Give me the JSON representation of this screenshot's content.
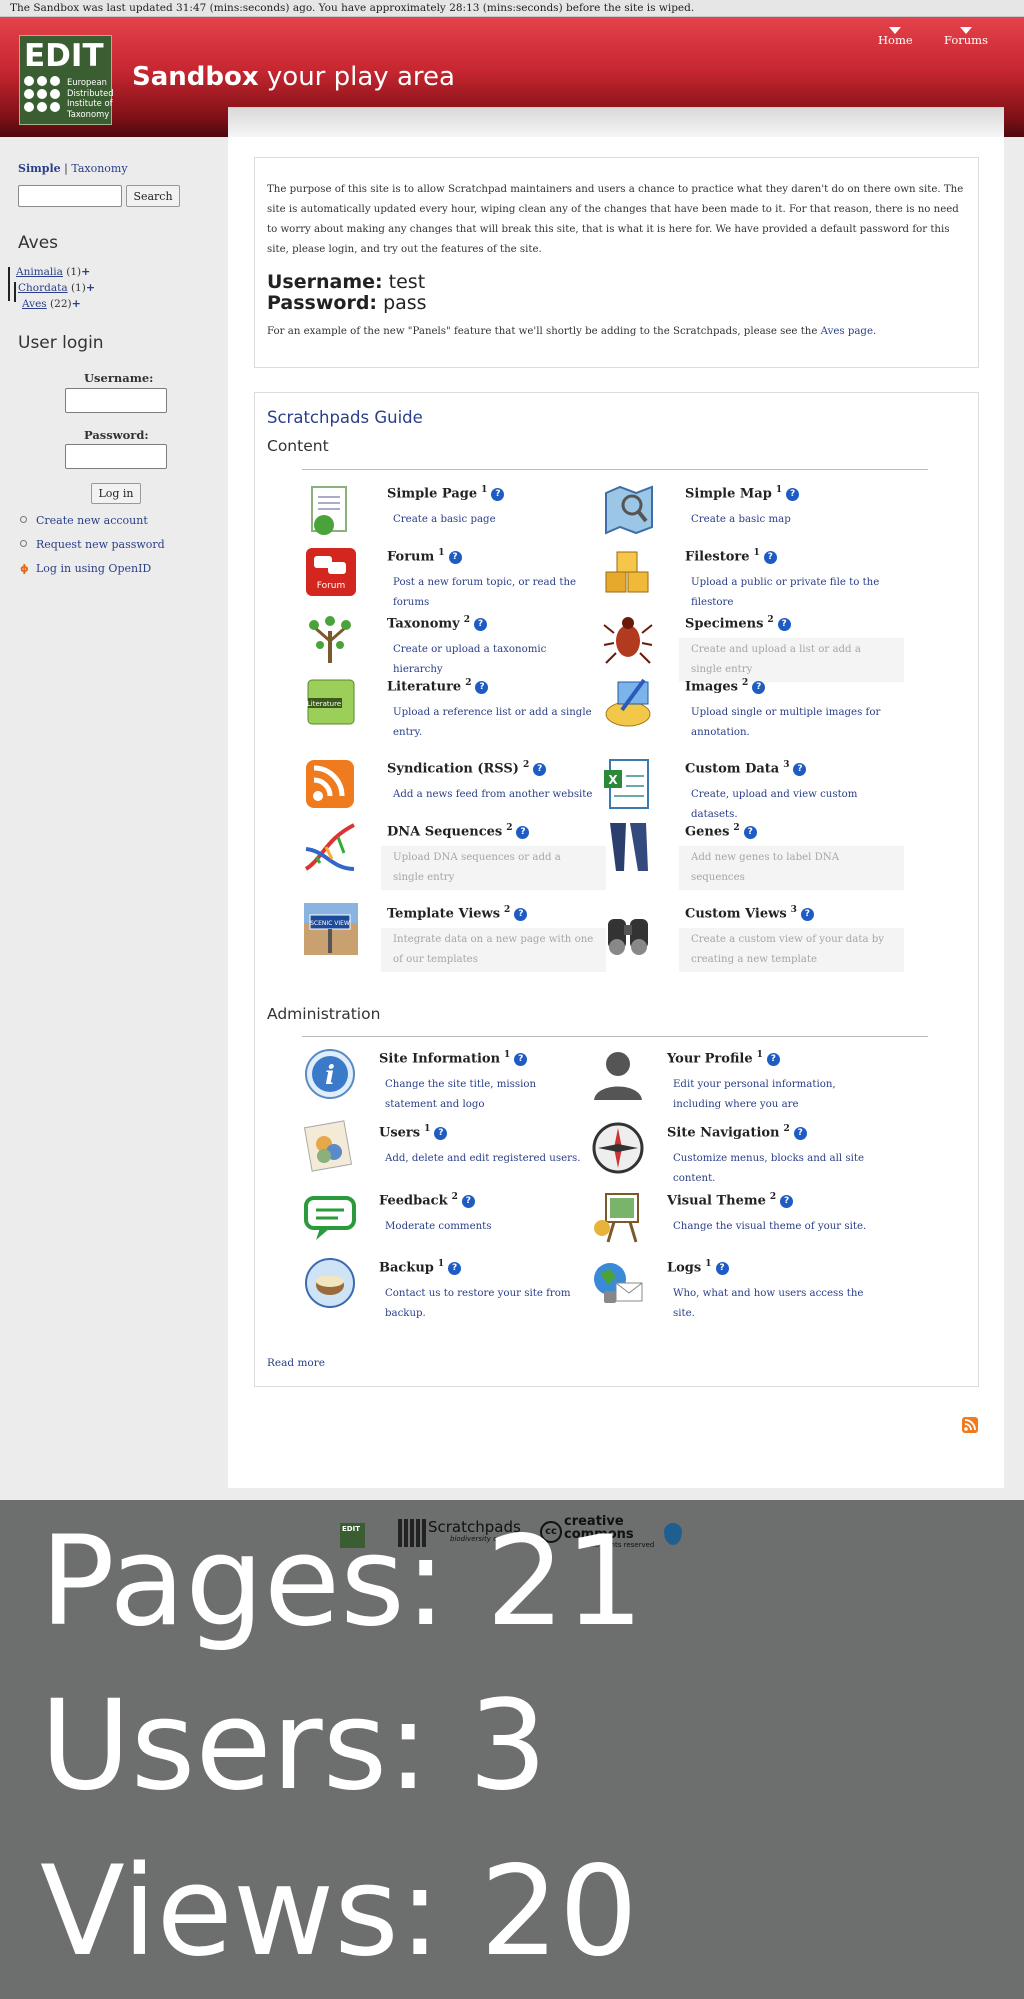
{
  "notice": "The Sandbox was last updated 31:47 (mins:seconds) ago. You have approximately 28:13 (mins:seconds) before the site is wiped.",
  "logo": {
    "main": "EDIT",
    "lines": [
      "European",
      "Distributed",
      "Institute of",
      "Taxonomy"
    ]
  },
  "site": {
    "name": "Sandbox",
    "slogan": "your play area"
  },
  "topnav": [
    "Home",
    "Forums"
  ],
  "sidebar": {
    "tabs": [
      "Simple",
      "Taxonomy"
    ],
    "tab_separator": "|",
    "search_button": "Search",
    "tree_title": "Aves",
    "tree": [
      {
        "label": "Animalia",
        "count": "(1)"
      },
      {
        "label": "Chordata",
        "count": "(1)"
      },
      {
        "label": "Aves",
        "count": "(22)"
      }
    ],
    "login_title": "User login",
    "username_label": "Username:",
    "password_label": "Password:",
    "required_mark": "*",
    "login_button": "Log in",
    "links": [
      "Create new account",
      "Request new password",
      "Log in using OpenID"
    ]
  },
  "intro": {
    "paragraph": "The purpose of this site is to allow Scratchpad maintainers and users a chance to practice what they daren't do on there own site. The site is automatically updated every hour, wiping clean any of the changes that have been made to it. For that reason, there is no need to worry about making any changes that will break this site, that is what it is here for. We have provided a default password for this site, please login, and try out the features of the site.",
    "username_label": "Username:",
    "username_value": "test",
    "password_label": "Password:",
    "password_value": "pass",
    "panels_before": "For an example of the new \"Panels\" feature that we'll shortly be adding to the Scratchpads, please see the",
    "panels_link": "Aves page",
    "panels_after": "."
  },
  "guide": {
    "title": "Scratchpads Guide",
    "content_title": "Content",
    "admin_title": "Administration",
    "help_glyph": "?",
    "read_more": "Read more",
    "content_items": [
      {
        "name": "Simple Page",
        "sup": "1",
        "desc": "Create a basic page",
        "disabled": false,
        "icon": "simple-page-icon"
      },
      {
        "name": "Simple Map",
        "sup": "1",
        "desc": "Create a basic map",
        "disabled": false,
        "icon": "simple-map-icon"
      },
      {
        "name": "Forum",
        "sup": "1",
        "desc": "Post a new forum topic, or read the forums",
        "disabled": false,
        "icon": "forum-icon"
      },
      {
        "name": "Filestore",
        "sup": "1",
        "desc": "Upload a public or private file to the filestore",
        "disabled": false,
        "icon": "filestore-icon"
      },
      {
        "name": "Taxonomy",
        "sup": "2",
        "desc": "Create or upload a taxonomic hierarchy",
        "disabled": false,
        "icon": "taxonomy-icon"
      },
      {
        "name": "Specimens",
        "sup": "2",
        "desc": "Create and upload a list or add a single entry",
        "disabled": true,
        "icon": "specimens-icon"
      },
      {
        "name": "Literature",
        "sup": "2",
        "desc": "Upload a reference list or add a single entry.",
        "disabled": false,
        "icon": "literature-icon"
      },
      {
        "name": "Images",
        "sup": "2",
        "desc": "Upload single or multiple images for annotation.",
        "disabled": false,
        "icon": "images-icon"
      },
      {
        "name": "Syndication (RSS)",
        "sup": "2",
        "desc": "Add a news feed from another website",
        "disabled": false,
        "icon": "rss-icon"
      },
      {
        "name": "Custom Data",
        "sup": "3",
        "desc": "Create, upload and view custom datasets.",
        "disabled": false,
        "icon": "custom-data-icon"
      },
      {
        "name": "DNA Sequences",
        "sup": "2",
        "desc": "Upload DNA sequences or add a single entry",
        "disabled": true,
        "icon": "dna-icon"
      },
      {
        "name": "Genes",
        "sup": "2",
        "desc": "Add new genes to label DNA sequences",
        "disabled": true,
        "icon": "genes-icon"
      },
      {
        "name": "Template Views",
        "sup": "2",
        "desc": "Integrate data on a new page with one of our templates",
        "disabled": true,
        "icon": "template-views-icon"
      },
      {
        "name": "Custom Views",
        "sup": "3",
        "desc": "Create a custom view of your data by creating a new template",
        "disabled": true,
        "icon": "custom-views-icon"
      }
    ],
    "admin_items": [
      {
        "name": "Site Information",
        "sup": "1",
        "desc": "Change the site title, mission statement and logo",
        "icon": "site-info-icon"
      },
      {
        "name": "Your Profile",
        "sup": "1",
        "desc": "Edit your personal information, including where you are",
        "icon": "profile-icon"
      },
      {
        "name": "Users",
        "sup": "1",
        "desc": "Add, delete and edit registered users.",
        "icon": "users-icon"
      },
      {
        "name": "Site Navigation",
        "sup": "2",
        "desc": "Customize menus, blocks and all site content.",
        "icon": "site-navigation-icon"
      },
      {
        "name": "Feedback",
        "sup": "2",
        "desc": "Moderate comments",
        "icon": "feedback-icon"
      },
      {
        "name": "Visual Theme",
        "sup": "2",
        "desc": "Change the visual theme of your site.",
        "icon": "visual-theme-icon"
      },
      {
        "name": "Backup",
        "sup": "1",
        "desc": "Contact us to restore your site from backup.",
        "icon": "backup-icon"
      },
      {
        "name": "Logs",
        "sup": "1",
        "desc": "Who, what and how users access the site.",
        "icon": "logs-icon"
      }
    ]
  },
  "footer_logos": {
    "edit": "EDIT",
    "scratchpads": "Scratchpads",
    "scratchpads_sub": "biodiversity online",
    "cc": "creative commons",
    "cc_sub": "some rights reserved"
  },
  "stats": {
    "pages": "Pages: 21",
    "users": "Users: 3",
    "views": "Views: 20"
  },
  "colors": {
    "header_red": "#c62630",
    "link_blue": "#2a3f88",
    "footer_gray": "#6d6e6e"
  }
}
